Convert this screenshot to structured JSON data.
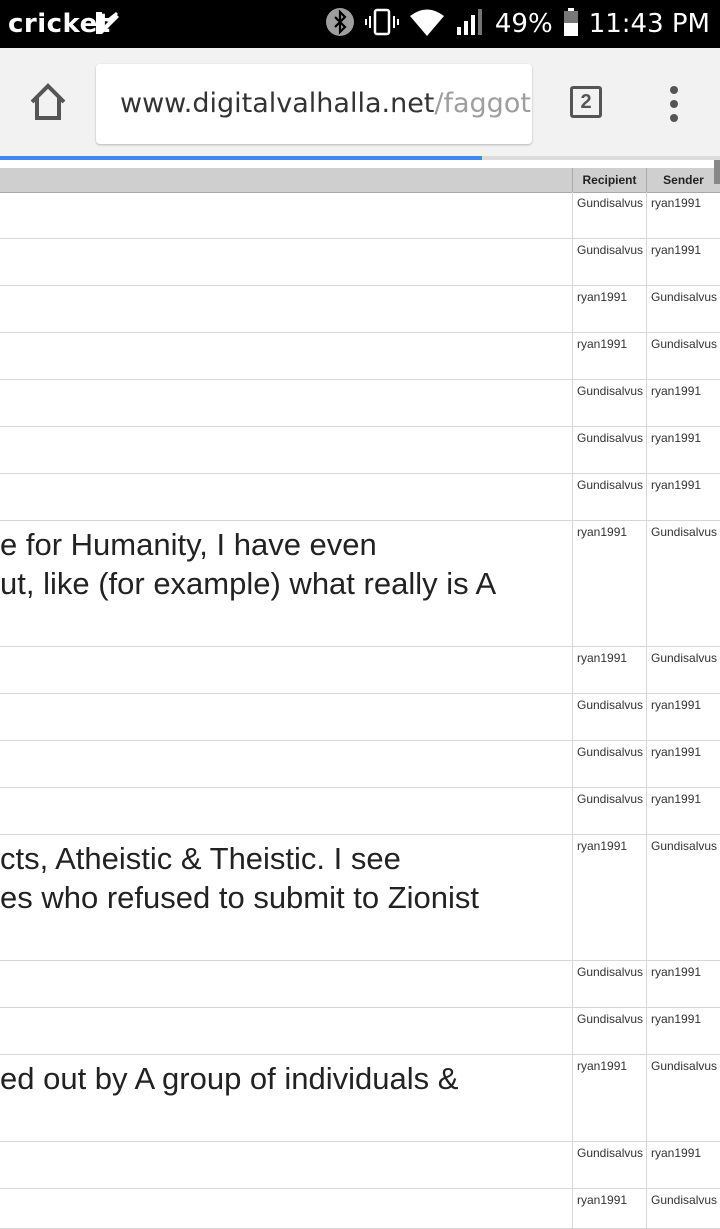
{
  "status_bar": {
    "carrier": "cricket",
    "battery": "49%",
    "time": "11:43 PM"
  },
  "browser": {
    "url_host": "www.digitalvalhalla.net",
    "url_path": "/faggot",
    "tab_count": "2",
    "load_progress": 0.67
  },
  "table": {
    "columns": [
      "Recipient",
      "Sender"
    ],
    "rows": [
      {
        "recipient": "Gundisalvus",
        "sender": "ryan1991",
        "lines": []
      },
      {
        "recipient": "Gundisalvus",
        "sender": "ryan1991",
        "lines": []
      },
      {
        "recipient": "ryan1991",
        "sender": "Gundisalvus",
        "lines": []
      },
      {
        "recipient": "ryan1991",
        "sender": "Gundisalvus",
        "lines": []
      },
      {
        "recipient": "Gundisalvus",
        "sender": "ryan1991",
        "lines": []
      },
      {
        "recipient": "Gundisalvus",
        "sender": "ryan1991",
        "lines": []
      },
      {
        "recipient": "Gundisalvus",
        "sender": "ryan1991",
        "lines": []
      },
      {
        "recipient": "ryan1991",
        "sender": "Gundisalvus",
        "lines": [
          "e for Humanity, I have even",
          "ut, like (for example) what really is A"
        ]
      },
      {
        "recipient": "ryan1991",
        "sender": "Gundisalvus",
        "lines": []
      },
      {
        "recipient": "Gundisalvus",
        "sender": "ryan1991",
        "lines": []
      },
      {
        "recipient": "Gundisalvus",
        "sender": "ryan1991",
        "lines": []
      },
      {
        "recipient": "Gundisalvus",
        "sender": "ryan1991",
        "lines": []
      },
      {
        "recipient": "ryan1991",
        "sender": "Gundisalvus",
        "lines": [
          "cts, Atheistic & Theistic. I see",
          "es who refused to submit to Zionist"
        ]
      },
      {
        "recipient": "Gundisalvus",
        "sender": "ryan1991",
        "lines": []
      },
      {
        "recipient": "Gundisalvus",
        "sender": "ryan1991",
        "lines": []
      },
      {
        "recipient": "ryan1991",
        "sender": "Gundisalvus",
        "lines": [
          "ed out by A group of individuals &"
        ]
      },
      {
        "recipient": "Gundisalvus",
        "sender": "ryan1991",
        "lines": []
      },
      {
        "recipient": "ryan1991",
        "sender": "Gundisalvus",
        "lines": []
      }
    ]
  },
  "colors": {
    "status_bar_bg": "#000000",
    "toolbar_bg": "#f2f2f2",
    "progress": "#4285f4",
    "header_bg": "#cfcfcf"
  }
}
